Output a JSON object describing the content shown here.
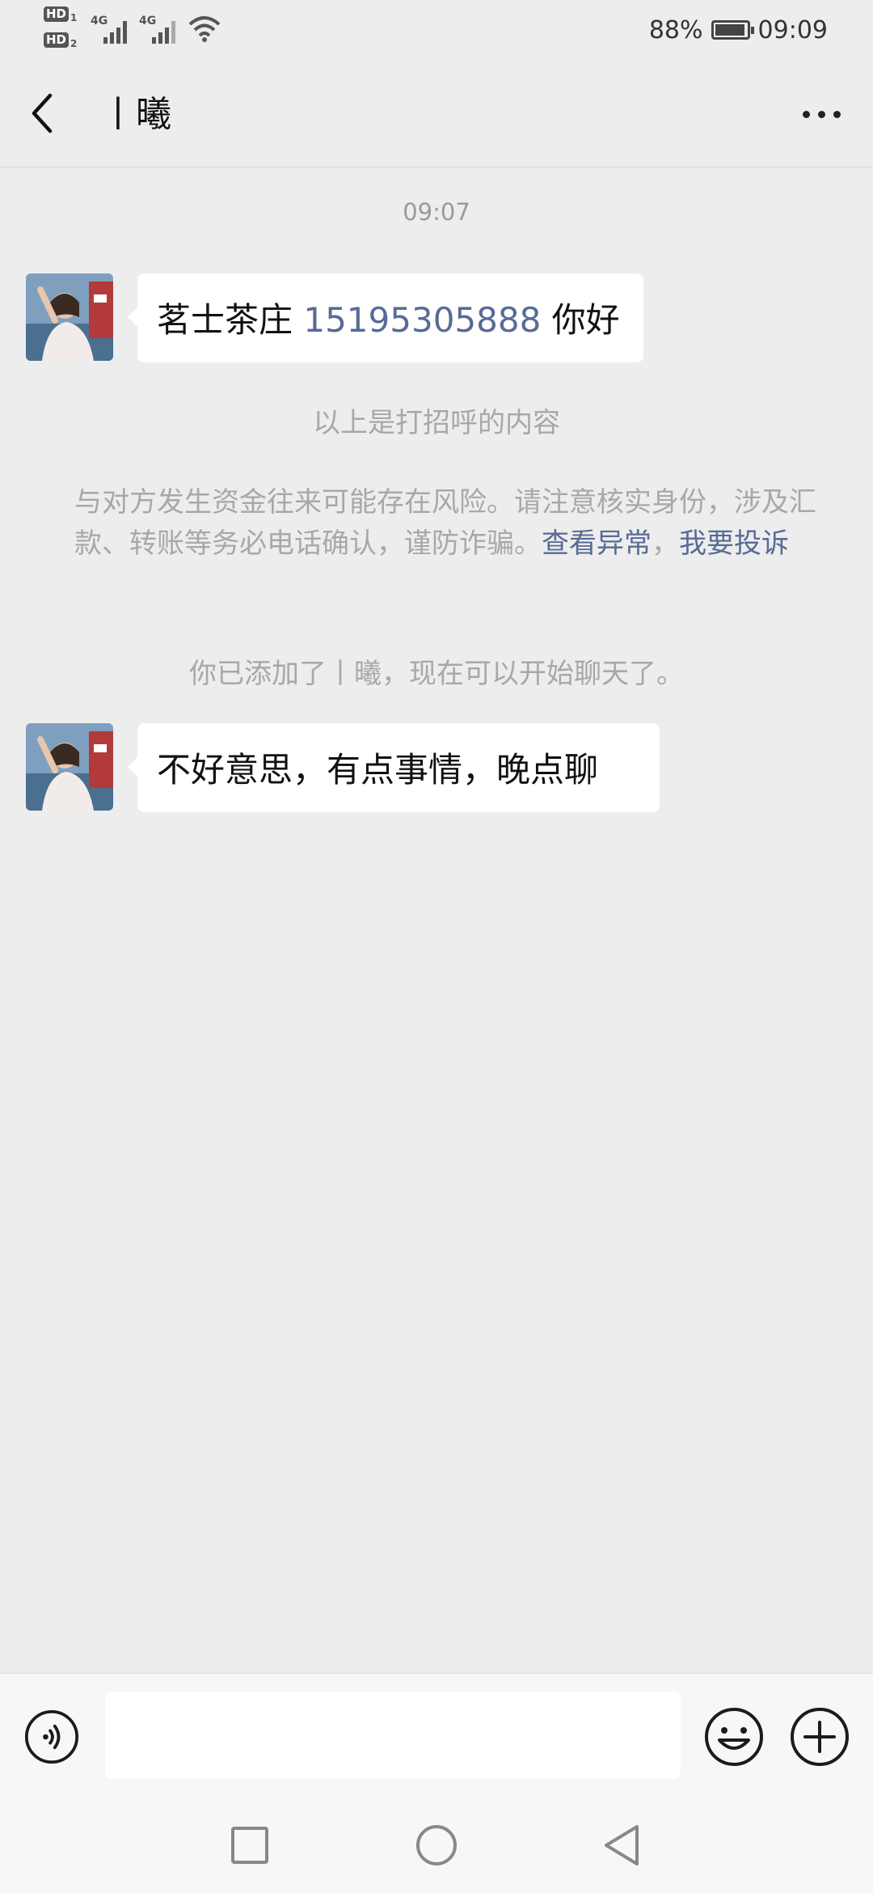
{
  "status_bar": {
    "hd1": "HD",
    "hd1_sub": "1",
    "hd2": "HD",
    "hd2_sub": "2",
    "network1": "4G",
    "network2": "4G",
    "battery_percent": "88%",
    "time": "09:09"
  },
  "header": {
    "title": "丨曦",
    "back_icon": "chevron-left-icon",
    "more_icon": "more-dots-icon"
  },
  "chat": {
    "timestamp": "09:07",
    "messages": [
      {
        "prefix": "茗士茶庄 ",
        "phone": "15195305888",
        "suffix": " 你好"
      },
      {
        "text": "不好意思，有点事情，晚点聊"
      }
    ],
    "greeting_note": "以上是打招呼的内容",
    "warning": {
      "text": "与对方发生资金往来可能存在风险。请注意核实身份，涉及汇款、转账等务必电话确认，谨防诈骗。",
      "link_view": "查看异常",
      "separator": "，",
      "link_report": "我要投诉"
    },
    "added_note": "你已添加了丨曦，现在可以开始聊天了。"
  },
  "input_bar": {
    "voice_icon": "voice-icon",
    "emoji_icon": "emoji-icon",
    "plus_icon": "plus-icon",
    "text_value": ""
  },
  "nav_bar": {
    "recent_icon": "square-icon",
    "home_icon": "circle-icon",
    "back_icon": "triangle-back-icon"
  },
  "colors": {
    "background": "#ededed",
    "link": "#576b95",
    "bubble": "#ffffff",
    "muted_text": "#a8a8a8"
  }
}
